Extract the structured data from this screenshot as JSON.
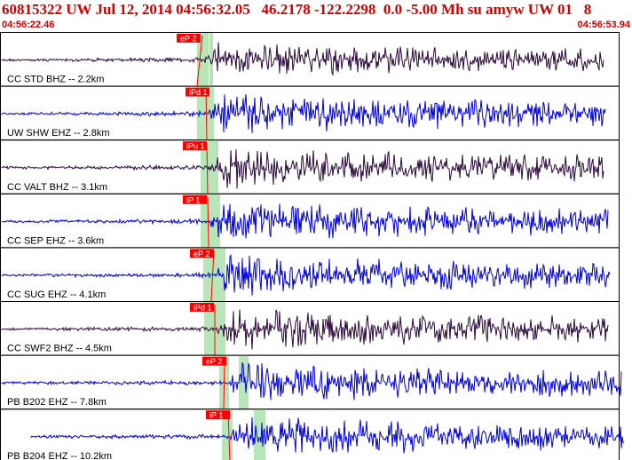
{
  "header": {
    "title": "60815322 UW Jul 12, 2014 04:56:32.05   46.2178 -122.2298  0.0 -5.00 Mh su amyw UW 01   8",
    "start_time": "04:56:22.46",
    "end_time": "04:56:53.94"
  },
  "colors": {
    "header_text": "#d00000",
    "pick_marker": "#ff0000",
    "pick_window": "#b8e6b8",
    "trace_dark": "#2a0a3a",
    "trace_blue": "#0000dd"
  },
  "traces": [
    {
      "label": "CC STD BHZ -- 2.2km",
      "pick": "eP 2",
      "color": "dark"
    },
    {
      "label": "UW SHW EHZ -- 2.8km",
      "pick": "iPd 1",
      "color": "blue"
    },
    {
      "label": "CC VALT BHZ -- 3.1km",
      "pick": "iPu 1",
      "color": "dark"
    },
    {
      "label": "CC SEP EHZ -- 3.6km",
      "pick": "iP 1",
      "color": "blue"
    },
    {
      "label": "CC SUG EHZ -- 4.1km",
      "pick": "eP 2",
      "color": "blue"
    },
    {
      "label": "CC SWF2 BHZ -- 4.5km",
      "pick": "iPd 1",
      "color": "dark"
    },
    {
      "label": "PB B202 EHZ -- 7.8km",
      "pick": "eP 2",
      "color": "blue"
    },
    {
      "label": "PB B204 EHZ -- 10.2km",
      "pick": "iP 1",
      "color": "blue"
    }
  ]
}
